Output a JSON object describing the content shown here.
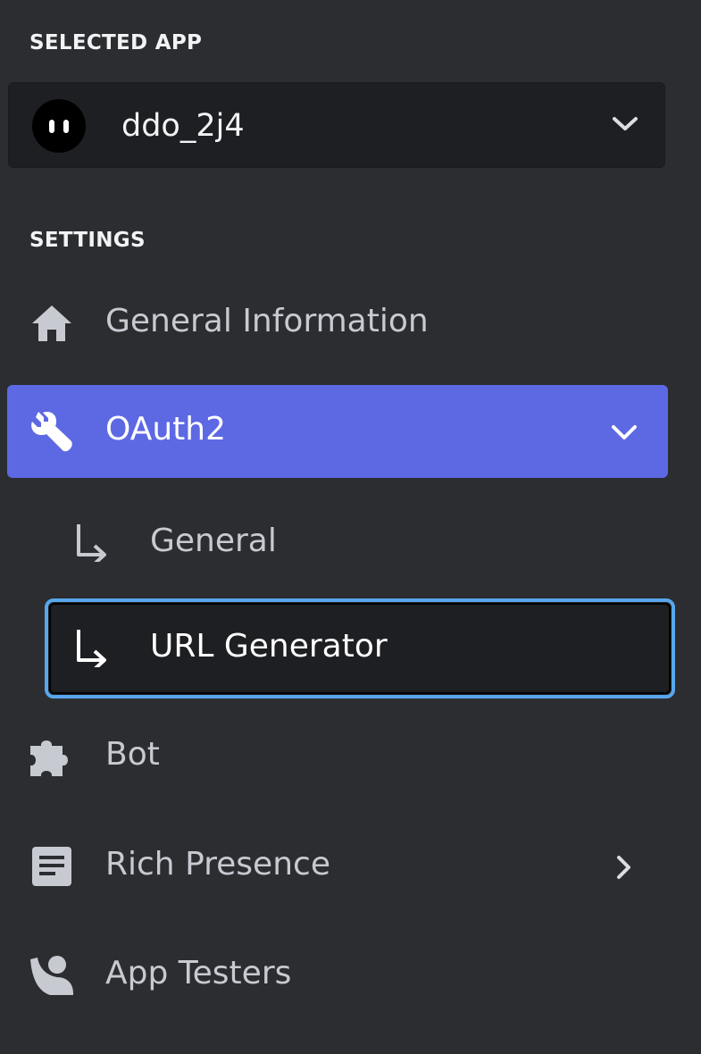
{
  "sidebar": {
    "selected_app_title": "SELECTED APP",
    "selected_app": {
      "name": "ddo_2j4",
      "avatar_icon": "robot-face-icon"
    },
    "settings_title": "SETTINGS",
    "items": [
      {
        "label": "General Information",
        "icon": "home-icon"
      },
      {
        "label": "OAuth2",
        "icon": "wrench-icon",
        "active": true,
        "expanded": true,
        "subitems": [
          {
            "label": "General",
            "icon": "sub-arrow-icon"
          },
          {
            "label": "URL Generator",
            "icon": "sub-arrow-icon",
            "focused": true
          }
        ]
      },
      {
        "label": "Bot",
        "icon": "puzzle-icon"
      },
      {
        "label": "Rich Presence",
        "icon": "document-icon",
        "has_submenu": true
      },
      {
        "label": "App Testers",
        "icon": "user-tester-icon"
      }
    ]
  },
  "colors": {
    "background": "#2b2d31",
    "selector_background": "#1e1f22",
    "active_item": "#5d68e3",
    "focus_ring": "#58a6ec"
  }
}
